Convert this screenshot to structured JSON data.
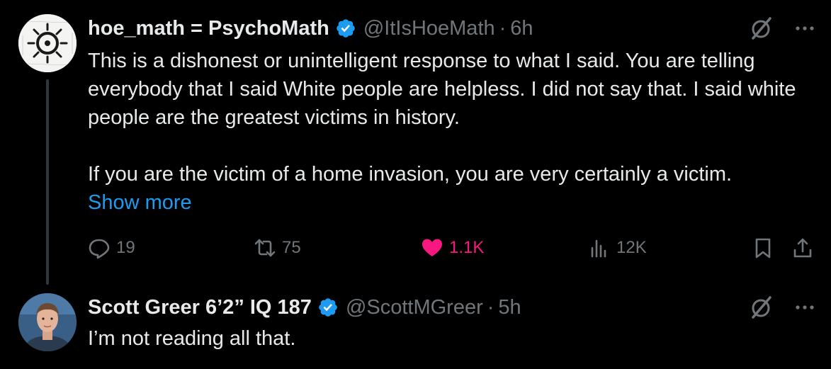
{
  "tweets": [
    {
      "display_name": "hoe_math = PsychoMath",
      "verified": true,
      "handle": "@ItIsHoeMath",
      "separator": "·",
      "time": "6h",
      "paragraphs": [
        "This is a dishonest or unintelligent response to what I said. You are telling everybody that I said White people are helpless. I did not say that. I said white people are the greatest victims in history.",
        "If you are the victim of a home invasion, you are very certainly a victim."
      ],
      "show_more": "Show more",
      "actions": {
        "replies": "19",
        "reposts": "75",
        "likes": "1.1K",
        "views": "12K"
      }
    },
    {
      "display_name": "Scott Greer 6’2” IQ 187",
      "verified": true,
      "handle": "@ScottMGreer",
      "separator": "·",
      "time": "5h",
      "paragraphs": [
        "I’m not reading all that."
      ]
    }
  ],
  "colors": {
    "background": "#000000",
    "text": "#e7e9ea",
    "secondary": "#71767b",
    "link": "#1d9bf0",
    "like": "#f91880",
    "verified": "#1d9bf0",
    "thread_line": "#333639"
  },
  "icons": [
    "verified-badge-icon",
    "grok-icon",
    "more-icon",
    "reply-icon",
    "repost-icon",
    "like-icon",
    "views-icon",
    "bookmark-icon",
    "share-icon"
  ]
}
